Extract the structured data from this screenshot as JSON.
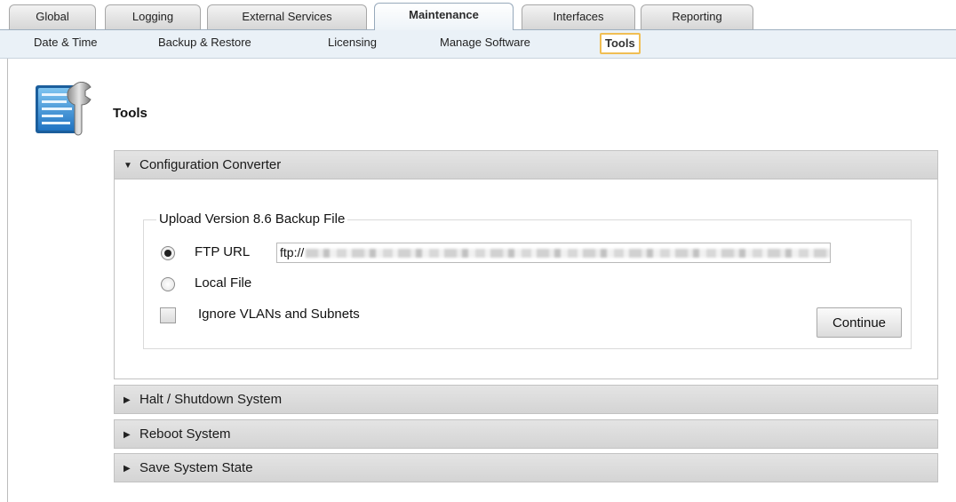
{
  "tabs": [
    {
      "label": "Global"
    },
    {
      "label": "Logging"
    },
    {
      "label": "External Services"
    },
    {
      "label": "Maintenance",
      "active": true
    },
    {
      "label": "Interfaces"
    },
    {
      "label": "Reporting"
    }
  ],
  "subnav": [
    {
      "label": "Date & Time"
    },
    {
      "label": "Backup & Restore"
    },
    {
      "label": "Licensing"
    },
    {
      "label": "Manage Software"
    },
    {
      "label": "Tools",
      "active": true
    }
  ],
  "page": {
    "title": "Tools",
    "icon": "tools-config-icon"
  },
  "panels": {
    "config_converter": {
      "title": "Configuration Converter",
      "expanded": true,
      "fieldset_legend": "Upload Version 8.6 Backup File",
      "ftp_label": "FTP URL",
      "ftp_selected": true,
      "ftp_value": "ftp://",
      "local_label": "Local File",
      "ignore_label": "Ignore VLANs and Subnets",
      "ignore_checked": false,
      "continue_label": "Continue"
    },
    "halt": {
      "title": "Halt / Shutdown System",
      "expanded": false
    },
    "reboot": {
      "title": "Reboot System",
      "expanded": false
    },
    "save_state": {
      "title": "Save System State",
      "expanded": false
    }
  },
  "colors": {
    "active_tab_outline": "#f0be54",
    "subnav_bg": "#eaf1f7",
    "panel_header": "#dcdcdc"
  }
}
